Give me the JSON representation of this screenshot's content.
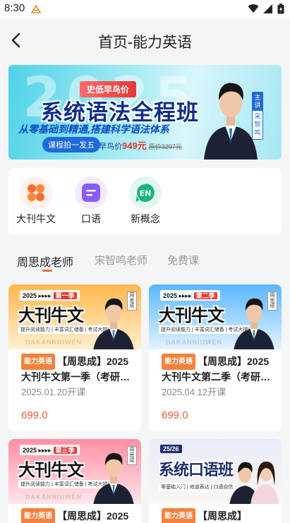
{
  "status_bar": {
    "time": "8:30"
  },
  "header": {
    "title": "首页-能力英语"
  },
  "banner": {
    "tag": "史低早鸟价",
    "title": "系统语法全程班",
    "subtitle": "从零基础到精通,搭建科学语法体系",
    "button": "课程拍一发五",
    "price_label": "早鸟价",
    "price": "949元",
    "original_price": "原价3297元",
    "teacher_label_1": "主讲",
    "teacher_label_2": "宋智鸣"
  },
  "categories": [
    {
      "label": "大刊牛文",
      "icon": "grid-icon",
      "color": "#fb6b33"
    },
    {
      "label": "口语",
      "icon": "chat-icon",
      "color": "#8a5cf6"
    },
    {
      "label": "新概念",
      "icon": "en-icon",
      "color": "#19b57a"
    }
  ],
  "tabs": [
    {
      "label": "周思成老师",
      "active": true
    },
    {
      "label": "宋智鸣老师",
      "active": false
    },
    {
      "label": "免费课",
      "active": false
    }
  ],
  "courses": [
    {
      "tag": "能力英语",
      "title": "【周思成】2025大刊牛文第一季（考研…",
      "date": "2025.01.20开课",
      "price": "699.0",
      "thumb": {
        "top": "2025 ▸▸▸▸",
        "season": "第一季",
        "title": "大刊牛文",
        "strip": "提升阅读能力 | 丰富词汇储备 | 考试大提分",
        "watermark": "DAKANNIUWEN",
        "name": "周思成"
      }
    },
    {
      "tag": "能力英语",
      "title": "【周思成】2025大刊牛文第二季（考研…",
      "date": "2025.04.12开课",
      "price": "699.0",
      "thumb": {
        "top": "2025 ▸▸▸▸",
        "season": "第二季",
        "title": "大刊牛文",
        "strip": "提升阅读能力 | 丰富词汇储备 | 考试大提分",
        "watermark": "DAKANNIUWEN",
        "name": "周思成"
      }
    },
    {
      "tag": "能力英语",
      "title": "【周思成】2025",
      "date": "",
      "price": "",
      "thumb": {
        "top": "2025 ▸▸▸▸",
        "season": "第三季",
        "title": "大刊牛文",
        "strip": "提升阅读能力 | 丰富词汇储备 | 考试大提分",
        "watermark": "DAKANNIUWEN",
        "name": "周思成"
      }
    },
    {
      "tag": "能力英语",
      "title": "【周思成】",
      "date": "",
      "price": "",
      "thumb": {
        "top": "25/26",
        "season": "",
        "title": "系统口语班",
        "strip": "零基础入门 | 地道表达 | 口语自信",
        "watermark": "",
        "name": ""
      }
    }
  ]
}
